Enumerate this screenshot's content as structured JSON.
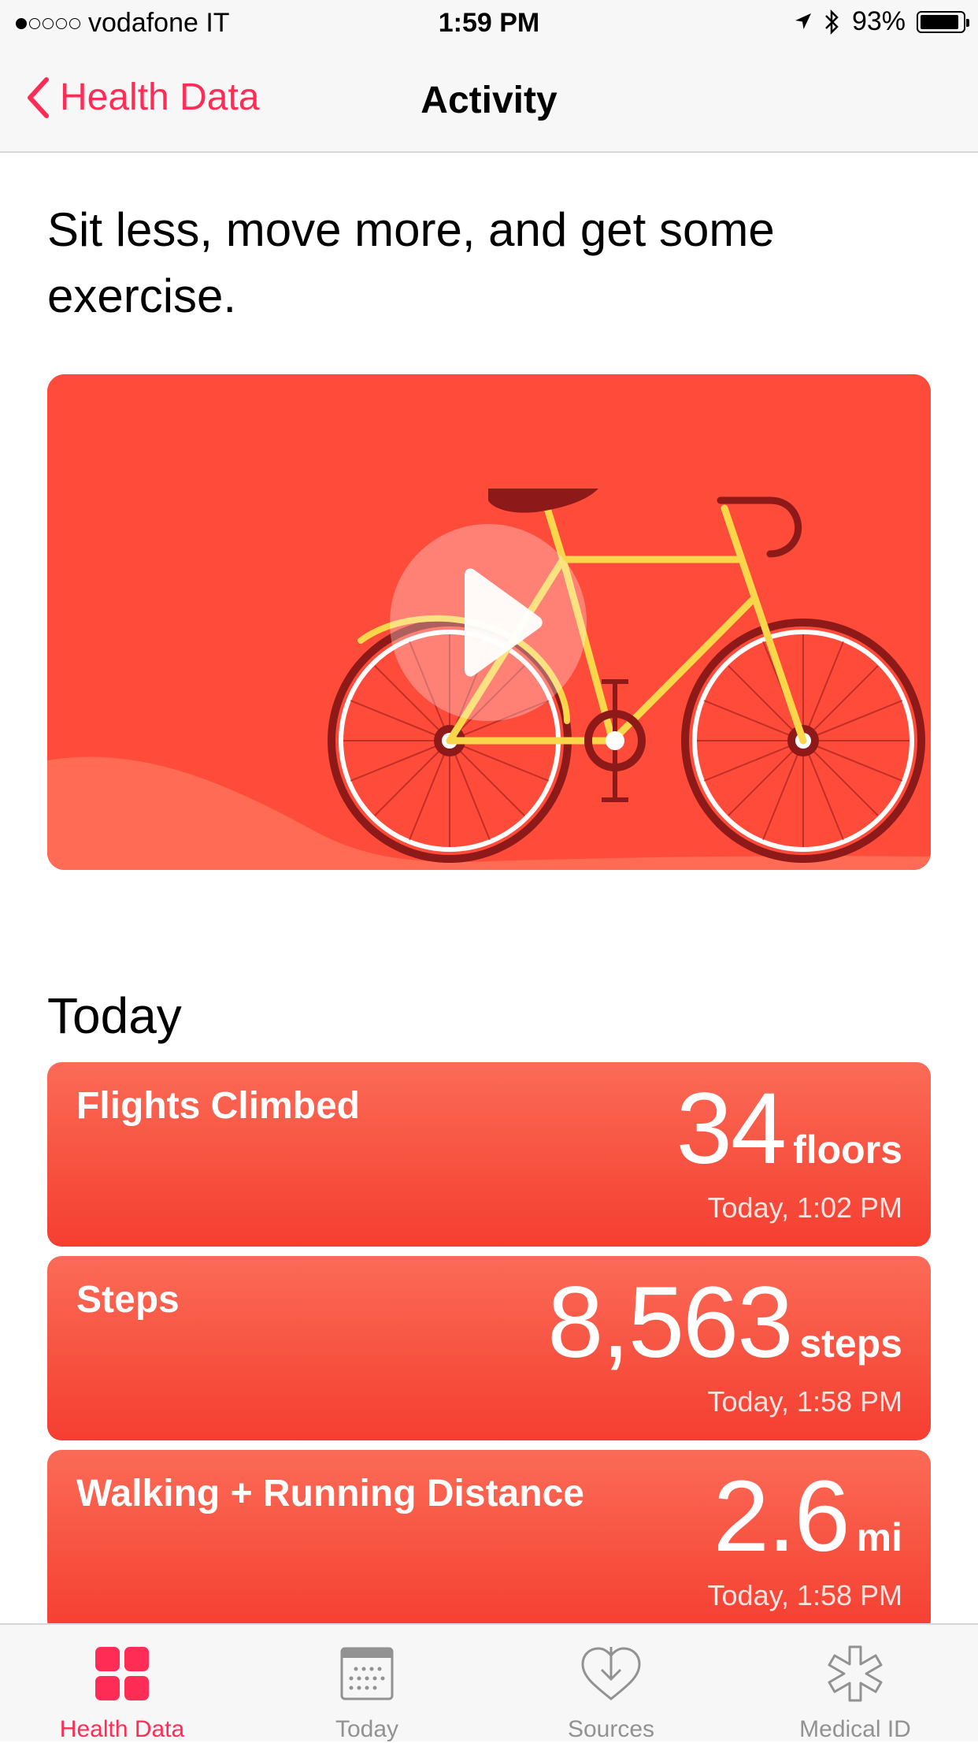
{
  "status_bar": {
    "carrier": "vodafone IT",
    "time": "1:59 PM",
    "battery": "93%",
    "battery_level": 0.93,
    "signal_bars_filled": 1,
    "signal_bars_total": 5
  },
  "nav": {
    "back_label": "Health Data",
    "title": "Activity"
  },
  "intro": {
    "text": "Sit less, move more, and get some exercise."
  },
  "today": {
    "heading": "Today",
    "cards": [
      {
        "label": "Flights Climbed",
        "value": "34",
        "unit": "floors",
        "date": "Today, 1:02 PM"
      },
      {
        "label": "Steps",
        "value": "8,563",
        "unit": "steps",
        "date": "Today, 1:58 PM"
      },
      {
        "label": "Walking + Running Distance",
        "value": "2.6",
        "unit": "mi",
        "date": "Today, 1:58 PM"
      }
    ]
  },
  "tabbar": {
    "tabs": [
      {
        "label": "Health Data",
        "icon": "grid-icon",
        "active": true
      },
      {
        "label": "Today",
        "icon": "calendar-icon",
        "active": false
      },
      {
        "label": "Sources",
        "icon": "heart-download-icon",
        "active": false
      },
      {
        "label": "Medical ID",
        "icon": "asterisk-icon",
        "active": false
      }
    ]
  },
  "colors": {
    "accent": "#ff2d55",
    "card_red": "#f7503f",
    "video_bg": "#ff4b3a",
    "bike_frame": "#f9d64a"
  }
}
